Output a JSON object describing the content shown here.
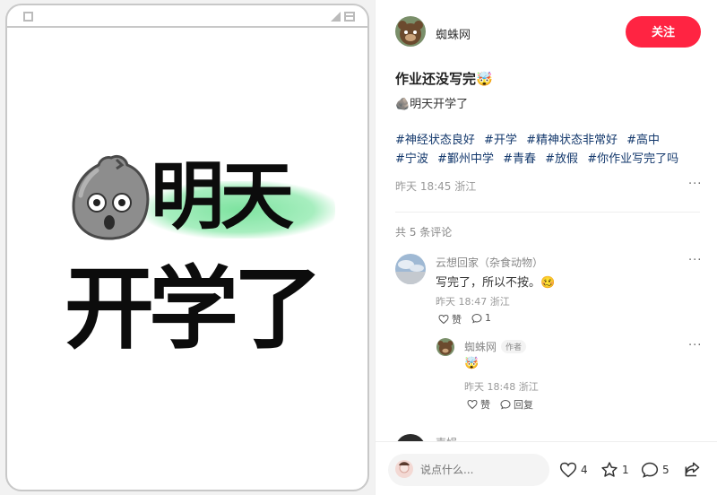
{
  "image": {
    "line1": "明天",
    "line2": "开学了",
    "highlight_color": "#7ee3a0"
  },
  "author": {
    "name": "蜘蛛网",
    "follow_label": "关注",
    "follow_color": "#ff2442"
  },
  "note": {
    "title": "作业还没写完🤯",
    "description": "🪨明天开学了",
    "tags": [
      "#神经状态良好",
      "#开学",
      "#精神状态非常好",
      "#高中",
      "#宁波",
      "#鄞州中学",
      "#青春",
      "#放假",
      "#你作业写完了吗"
    ],
    "time": "昨天 18:45",
    "location": "浙江",
    "more": "···"
  },
  "comments": {
    "count_label": "共 5 条评论",
    "items": [
      {
        "name": "云想回家（杂食动物）",
        "text": "写完了，所以不按。🥴",
        "time": "昨天 18:47",
        "location": "浙江",
        "like_label": "赞",
        "reply_count": "1",
        "more": "···"
      }
    ],
    "reply": {
      "name": "蜘蛛网",
      "author_tag": "作者",
      "text": "🤯",
      "time": "昨天 18:48",
      "location": "浙江",
      "like_label": "赞",
      "reply_label": "回复",
      "more": "···"
    },
    "partial_name": "声娟"
  },
  "bottom_bar": {
    "input_placeholder": "说点什么...",
    "likes": "4",
    "collects": "1",
    "comments": "5"
  },
  "icons": {
    "rock": "rock-face-icon",
    "heart": "heart-icon",
    "star": "star-icon",
    "comment": "comment-bubble-icon",
    "share": "share-icon"
  }
}
